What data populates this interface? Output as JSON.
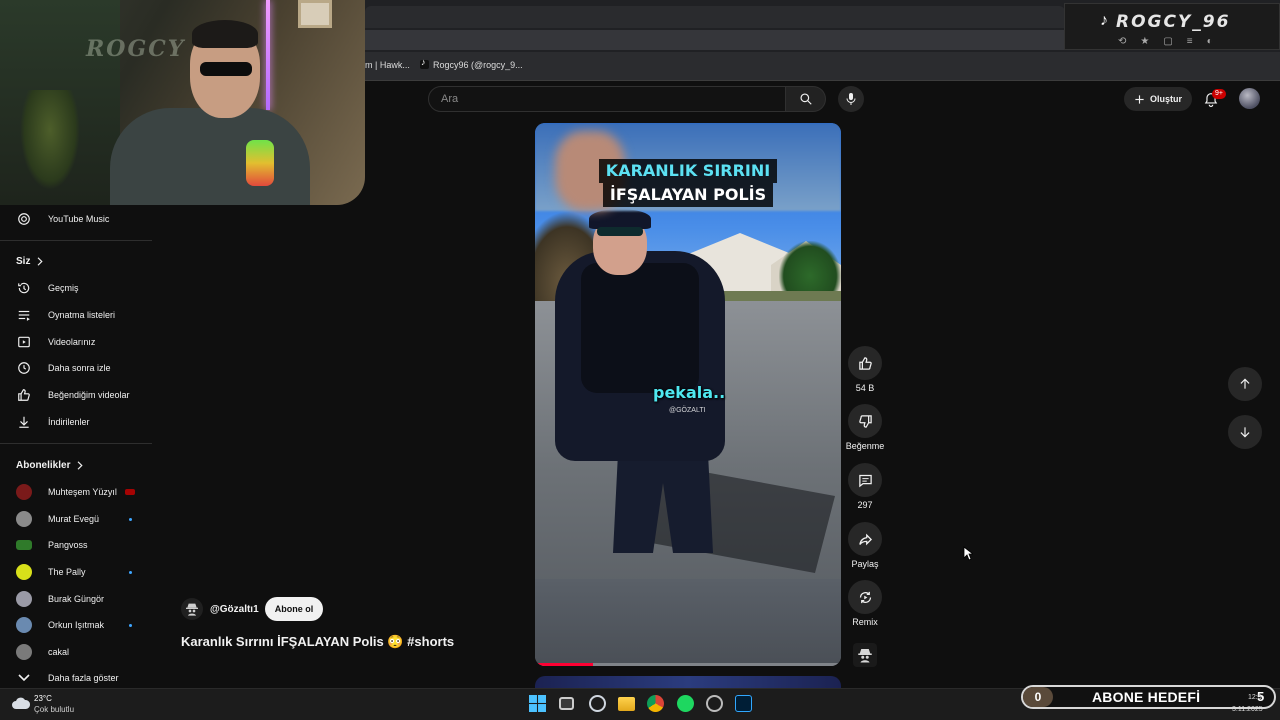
{
  "browser": {
    "bookmarks": [
      {
        "label": "m | Hawk..."
      },
      {
        "label": "Rogcy96 (@rogcy_9..."
      }
    ]
  },
  "stream_overlay": {
    "name": "ROGCY_96",
    "cam_logo": "ROGCY"
  },
  "header": {
    "search_placeholder": "Ara",
    "create_label": "Oluştur",
    "notification_count": "9+"
  },
  "sidebar": {
    "top_items": [
      {
        "label": "YouTube Music",
        "icon": "youtube-music-icon"
      }
    ],
    "you_section": {
      "title": "Siz",
      "items": [
        {
          "label": "Geçmiş",
          "icon": "history-icon"
        },
        {
          "label": "Oynatma listeleri",
          "icon": "playlist-icon"
        },
        {
          "label": "Videolarınız",
          "icon": "your-videos-icon"
        },
        {
          "label": "Daha sonra izle",
          "icon": "watch-later-icon"
        },
        {
          "label": "Beğendiğim videolar",
          "icon": "liked-icon"
        },
        {
          "label": "İndirilenler",
          "icon": "download-icon"
        }
      ]
    },
    "subscriptions": {
      "title": "Abonelikler",
      "items": [
        {
          "label": "Muhteşem Yüzyıl",
          "indicator": "live",
          "color": "#7a1a1a"
        },
        {
          "label": "Murat Evegü",
          "indicator": "dot",
          "color": "#8a8a8a"
        },
        {
          "label": "Pangvoss",
          "indicator": "none",
          "color": "#2f7a2a"
        },
        {
          "label": "The Pally",
          "indicator": "dot",
          "color": "#d8e01a"
        },
        {
          "label": "Burak Güngör",
          "indicator": "none",
          "color": "#9a9aa6"
        },
        {
          "label": "Orkun Işıtmak",
          "indicator": "dot",
          "color": "#6a8ab0"
        },
        {
          "label": "cakal",
          "indicator": "none",
          "color": "#7a7a7a"
        }
      ],
      "show_more": "Daha fazla göster"
    }
  },
  "short": {
    "overlay_title_line1": "KARANLIK SIRRINI",
    "overlay_title_line2": "İFŞALAYAN POLİS",
    "caption": "pekala..",
    "watermark": "@GÖZALTI",
    "progress": 0.19,
    "channel": "@Gözaltı1",
    "subscribe_label": "Abone ol",
    "title": "Karanlık Sırrını İFŞALAYAN Polis 😳 #shorts"
  },
  "actions": {
    "like_count": "54 B",
    "dislike_label": "Beğenme",
    "comment_count": "297",
    "share_label": "Paylaş",
    "remix_label": "Remix"
  },
  "taskbar": {
    "weather_temp": "23°C",
    "weather_desc": "Çok bulutlu",
    "goal_label": "ABONE HEDEFİ",
    "goal_start": "0",
    "goal_end": "5",
    "clock_time": "12:5",
    "clock_date": "3.11.2025"
  },
  "colors": {
    "accent_red": "#ff0033",
    "caption_cyan": "#4fe8f0"
  }
}
